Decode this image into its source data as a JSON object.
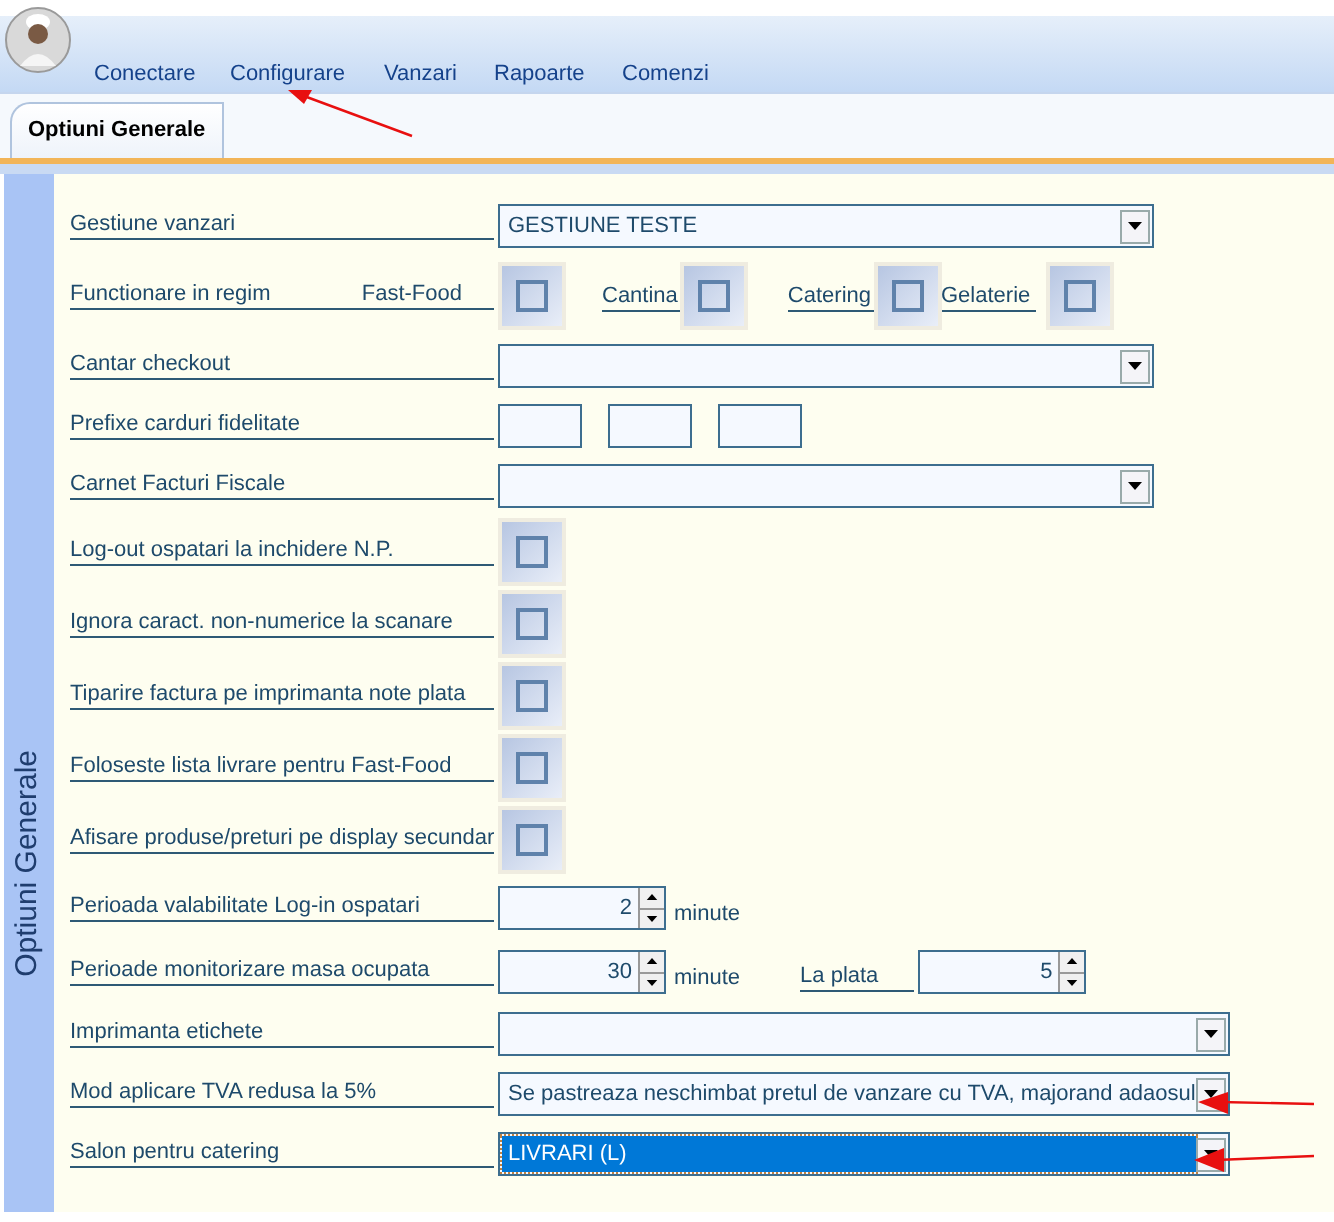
{
  "menu": [
    {
      "label": "Conectare"
    },
    {
      "label": "Configurare"
    },
    {
      "label": "Vanzari"
    },
    {
      "label": "Rapoarte"
    },
    {
      "label": "Comenzi"
    }
  ],
  "tabs": [
    {
      "label": "Optiuni Generale",
      "selected": true
    }
  ],
  "form": {
    "title": "Optiuni Generale",
    "rows": [
      {
        "kind": "dropdown",
        "label": "Gestiune vanzari",
        "value": "GESTIUNE TESTE",
        "highlighted": false
      },
      {
        "kind": "modes",
        "label": "Functionare in regim",
        "options": [
          {
            "label": "Fast-Food",
            "checked": false
          },
          {
            "label": "Cantina",
            "checked": false
          },
          {
            "label": "Catering",
            "checked": false
          },
          {
            "label": "Gelaterie",
            "checked": false
          }
        ]
      },
      {
        "kind": "dropdown",
        "label": "Cantar checkout",
        "highlighted": false
      },
      {
        "kind": "prefixes",
        "label": "Prefixe carduri fidelitate"
      },
      {
        "kind": "dropdown",
        "label": "Carnet Facturi Fiscale",
        "highlighted": false
      },
      {
        "kind": "checkbox",
        "label": "Log-out ospatari la inchidere N.P.",
        "checked": false
      },
      {
        "kind": "checkbox",
        "label": "Ignora caract. non-numerice la scanare",
        "checked": false
      },
      {
        "kind": "checkbox",
        "label": "Tiparire factura pe imprimanta note plata",
        "checked": false
      },
      {
        "kind": "checkbox",
        "label": "Foloseste lista livrare pentru Fast-Food",
        "checked": false
      },
      {
        "kind": "checkbox",
        "label": "Afisare produse/preturi pe display secundar",
        "checked": false
      },
      {
        "kind": "spinner",
        "label": "Perioada valabilitate Log-in ospatari",
        "value": "2",
        "unit": "minute"
      },
      {
        "kind": "spinner",
        "label": "Perioade monitorizare masa ocupata",
        "value": "30",
        "unit": "minute",
        "extra": {
          "label": "La plata",
          "value": "5"
        }
      },
      {
        "kind": "dropdown",
        "label": "Imprimanta etichete",
        "highlighted": false
      },
      {
        "kind": "dropdown",
        "label": "Mod aplicare TVA redusa la 5%",
        "value": "Se pastreaza neschimbat pretul de vanzare cu TVA, majorand adaosul",
        "highlighted": false
      },
      {
        "kind": "dropdown",
        "label": "Salon pentru catering",
        "value": "LIVRARI (L)",
        "highlighted": true
      }
    ]
  }
}
